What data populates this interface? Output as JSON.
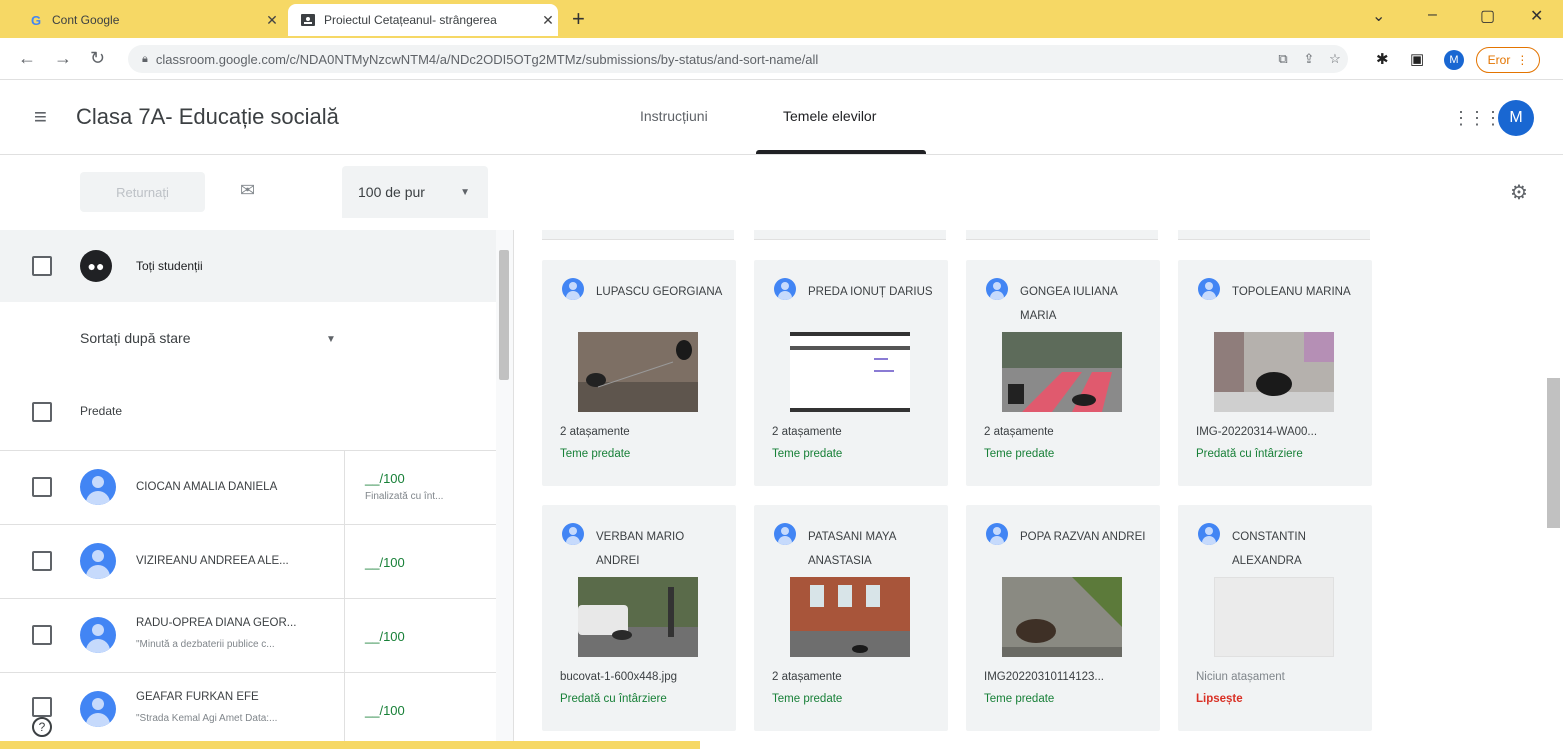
{
  "browser": {
    "tabs": [
      {
        "title": "Cont Google",
        "favicon": "G"
      },
      {
        "title": "Proiectul Cetațeanul- strângerea",
        "favicon": "classroom"
      }
    ],
    "url": "classroom.google.com/c/NDA0NTMyNzcwNTM4/a/NDc2ODI5OTg2MTMz/submissions/by-status/and-sort-name/all",
    "profile_initial": "M",
    "error_label": "Eror"
  },
  "classroom": {
    "class_title": "Clasa 7A- Educație socială",
    "tabs": {
      "instructions": "Instrucțiuni",
      "student_work": "Temele elevilor"
    },
    "avatar_initial": "M"
  },
  "toolbar": {
    "return_label": "Returnați",
    "points_label": "100 de pur"
  },
  "left": {
    "all_students_label": "Toți studenții",
    "sort_label": "Sortați după stare",
    "group_label": "Predate",
    "students": [
      {
        "name": "CIOCAN AMALIA DANIELA",
        "sub": "",
        "grade": "__/100",
        "grade_status": "Finalizată cu înt..."
      },
      {
        "name": "VIZIREANU ANDREEA ALE...",
        "sub": "",
        "grade": "__/100",
        "grade_status": ""
      },
      {
        "name": "RADU-OPREA DIANA GEOR...",
        "sub": "\"Minută a dezbaterii publice c...",
        "grade": "__/100",
        "grade_status": ""
      },
      {
        "name": "GEAFAR FURKAN EFE",
        "sub": "\"Strada Kemal Agi Amet Data:...",
        "grade": "__/100",
        "grade_status": ""
      }
    ]
  },
  "cards": [
    {
      "name": "LUPASCU GEORGIANA",
      "attachment": "2 atașamente",
      "status": "Teme predate",
      "kind": "photo-dogs"
    },
    {
      "name": "PREDA IONUȚ DARIUS",
      "attachment": "2 atașamente",
      "status": "Teme predate",
      "kind": "screenshot"
    },
    {
      "name": "GONGEA IULIANA MARIA",
      "attachment": "2 atașamente",
      "status": "Teme predate",
      "kind": "photo-crosswalk"
    },
    {
      "name": "TOPOLEANU MARINA",
      "attachment": "IMG-20220314-WA00...",
      "status": "Predată cu întârziere",
      "kind": "photo-dog-street"
    },
    {
      "name": "VERBAN MARIO ANDREI",
      "attachment": "bucovat-1-600x448.jpg",
      "status": "Predată cu întârziere",
      "kind": "photo-car"
    },
    {
      "name": "PATASANI MAYA ANASTASIA",
      "attachment": "2 atașamente",
      "status": "Teme predate",
      "kind": "photo-building"
    },
    {
      "name": "POPA RAZVAN ANDREI",
      "attachment": "IMG20220310114123...",
      "status": "Teme predate",
      "kind": "photo-dog-grass"
    },
    {
      "name": "CONSTANTIN ALEXANDRA",
      "attachment": "Niciun atașament",
      "status": "Lipsește",
      "kind": "empty"
    }
  ],
  "colors": {
    "accent": "#1967d2",
    "green": "#188038",
    "missing": "#d93025",
    "tabbar": "#f6d865"
  }
}
